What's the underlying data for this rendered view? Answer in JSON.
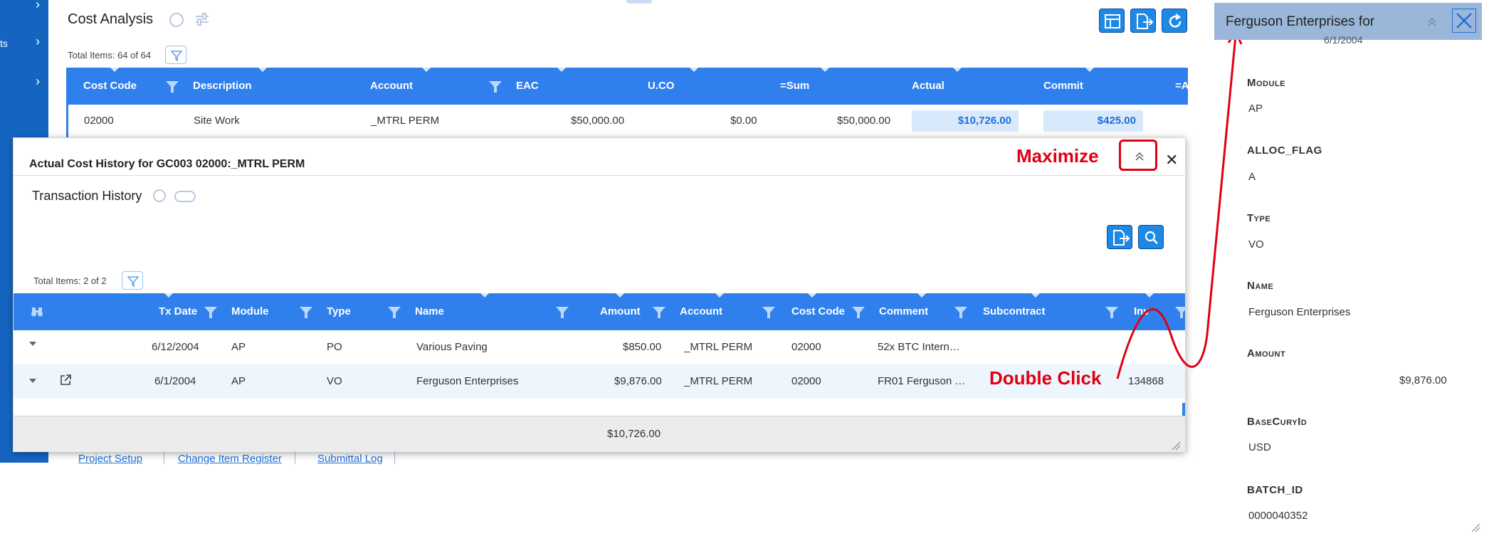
{
  "nav": {
    "partial_label": "ts"
  },
  "cost_analysis": {
    "title": "Cost Analysis",
    "total_items": "Total Items: 64 of 64",
    "columns": [
      "Cost Code",
      "Description",
      "Account",
      "EAC",
      "U.CO",
      "=Sum",
      "Actual",
      "Commit",
      "=A"
    ],
    "row": {
      "cost_code": "02000",
      "description": "Site Work",
      "account": "_MTRL PERM",
      "eac": "$50,000.00",
      "uco": "$0.00",
      "sum": "$50,000.00",
      "actual": "$10,726.00",
      "commit": "$425.00"
    }
  },
  "bottom_tabs": [
    "Project Setup",
    "Change Item Register",
    "Submittal Log"
  ],
  "modal": {
    "title": "Actual Cost History for GC003 02000:_MTRL PERM",
    "section_title": "Transaction History",
    "total_items": "Total Items: 2 of 2",
    "columns": [
      "Tx Date",
      "Module",
      "Type",
      "Name",
      "Amount",
      "Account",
      "Cost Code",
      "Comment",
      "Subcontract",
      "Inv"
    ],
    "rows": [
      {
        "tx_date": "6/12/2004",
        "module": "AP",
        "type": "PO",
        "name": "Various Paving",
        "amount": "$850.00",
        "account": "_MTRL PERM",
        "cost_code": "02000",
        "comment": "52x BTC Intern…",
        "subcontract": "",
        "inv": ""
      },
      {
        "tx_date": "6/1/2004",
        "module": "AP",
        "type": "VO",
        "name": "Ferguson Enterprises",
        "amount": "$9,876.00",
        "account": "_MTRL PERM",
        "cost_code": "02000",
        "comment": "FR01 Ferguson …",
        "subcontract": "",
        "inv": "134868"
      }
    ],
    "footer_total": "$10,726.00"
  },
  "annotations": {
    "maximize": "Maximize",
    "double_click": "Double Click"
  },
  "detail_panel": {
    "title": "Ferguson Enterprises for",
    "subtitle": "6/1/2004",
    "fields": [
      {
        "label": "Module",
        "value": "AP"
      },
      {
        "label": "ALLOC_FLAG",
        "value": "A"
      },
      {
        "label": "Type",
        "value": "VO"
      },
      {
        "label": "Name",
        "value": "Ferguson Enterprises"
      },
      {
        "label": "Amount",
        "value": "$9,876.00"
      },
      {
        "label": "BaseCuryId",
        "value": "USD"
      },
      {
        "label": "BATCH_ID",
        "value": "0000040352"
      }
    ]
  },
  "colors": {
    "brand_blue": "#2f80ed",
    "nav_blue": "#1565c0",
    "annotation_red": "#e00010",
    "panel_head": "#9ab7da"
  }
}
